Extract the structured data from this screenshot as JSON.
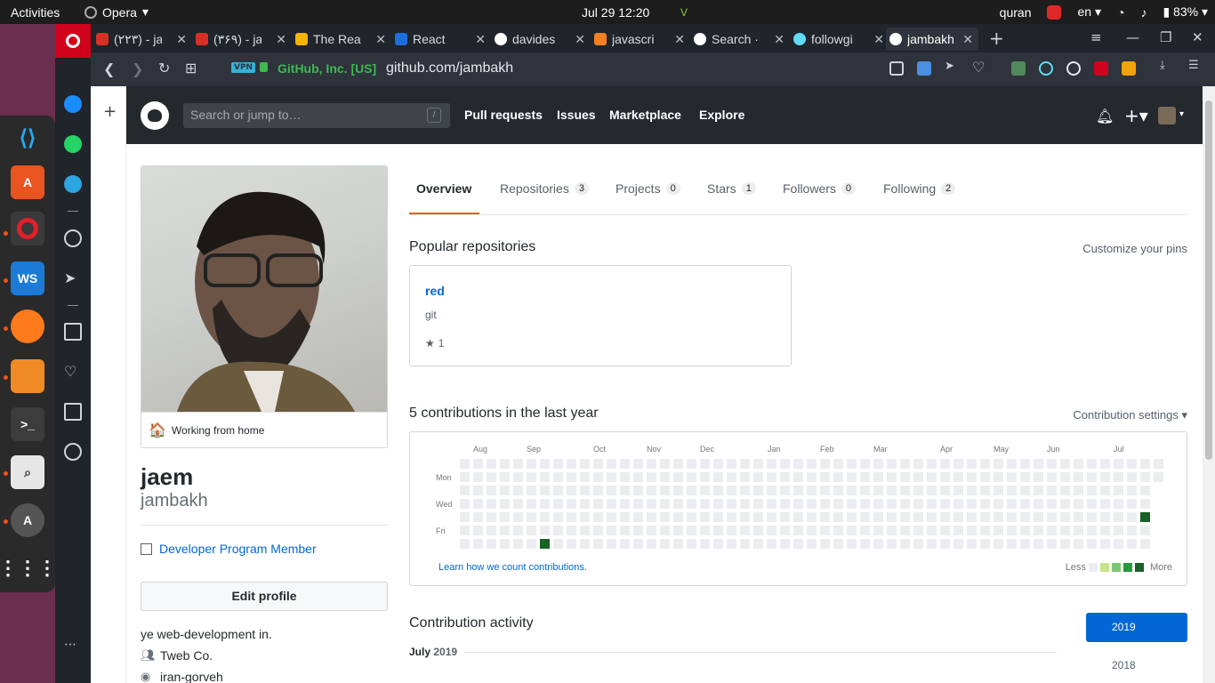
{
  "topbar": {
    "activities": "Activities",
    "app_name": "Opera",
    "clock": "Jul 29  12:20",
    "user_label": "quran",
    "lang": "en",
    "battery": "83%"
  },
  "browser": {
    "tabs": [
      {
        "label": "(۲۲۳) - ja",
        "icon_color": "#d93025"
      },
      {
        "label": "(۳۶۹) - ja",
        "icon_color": "#d93025"
      },
      {
        "label": "The Rea",
        "icon_color": "#f4b400"
      },
      {
        "label": "React",
        "icon_color": "#1d6fe0"
      },
      {
        "label": "davides",
        "icon_color": "#ffffff"
      },
      {
        "label": "javascri",
        "icon_color": "#f48024"
      },
      {
        "label": "Search ·",
        "icon_color": "#ffffff"
      },
      {
        "label": "followgi",
        "icon_color": "#61dafb"
      },
      {
        "label": "jambakh",
        "icon_color": "#ffffff"
      }
    ],
    "vpn": "VPN",
    "cert": "GitHub, Inc. [US]",
    "url": "github.com/jambakh"
  },
  "github": {
    "search_placeholder": "Search or jump to…",
    "slash": "/",
    "nav": [
      "Pull requests",
      "Issues",
      "Marketplace",
      "Explore"
    ]
  },
  "profile": {
    "status": "Working from home",
    "status_emoji": "🏠",
    "display_name": "jaem",
    "username": "jambakh",
    "badge": "Developer Program Member",
    "edit_button": "Edit profile",
    "bio": "ye web-development in.",
    "company": "Tweb Co.",
    "location": "iran-gorveh"
  },
  "tabs": [
    {
      "label": "Overview",
      "count": ""
    },
    {
      "label": "Repositories",
      "count": "3"
    },
    {
      "label": "Projects",
      "count": "0"
    },
    {
      "label": "Stars",
      "count": "1"
    },
    {
      "label": "Followers",
      "count": "0"
    },
    {
      "label": "Following",
      "count": "2"
    }
  ],
  "popular": {
    "title": "Popular repositories",
    "customize": "Customize your pins",
    "repo": {
      "name": "red",
      "description": "git",
      "stars": "1"
    }
  },
  "contributions": {
    "title": "5 contributions in the last year",
    "settings": "Contribution settings ▾",
    "months": [
      "Aug",
      "Sep",
      "Oct",
      "Nov",
      "Dec",
      "Jan",
      "Feb",
      "Mar",
      "Apr",
      "May",
      "Jun",
      "Jul"
    ],
    "days": [
      "Mon",
      "Wed",
      "Fri"
    ],
    "learn": "Learn how we count contributions.",
    "less": "Less",
    "more": "More",
    "colors": [
      "#ebedf0",
      "#c6e48b",
      "#7bc96f",
      "#239a3b",
      "#196127"
    ]
  },
  "activity": {
    "title": "Contribution activity",
    "period_month": "July",
    "period_year": "2019",
    "years": [
      "2019",
      "2018"
    ]
  }
}
